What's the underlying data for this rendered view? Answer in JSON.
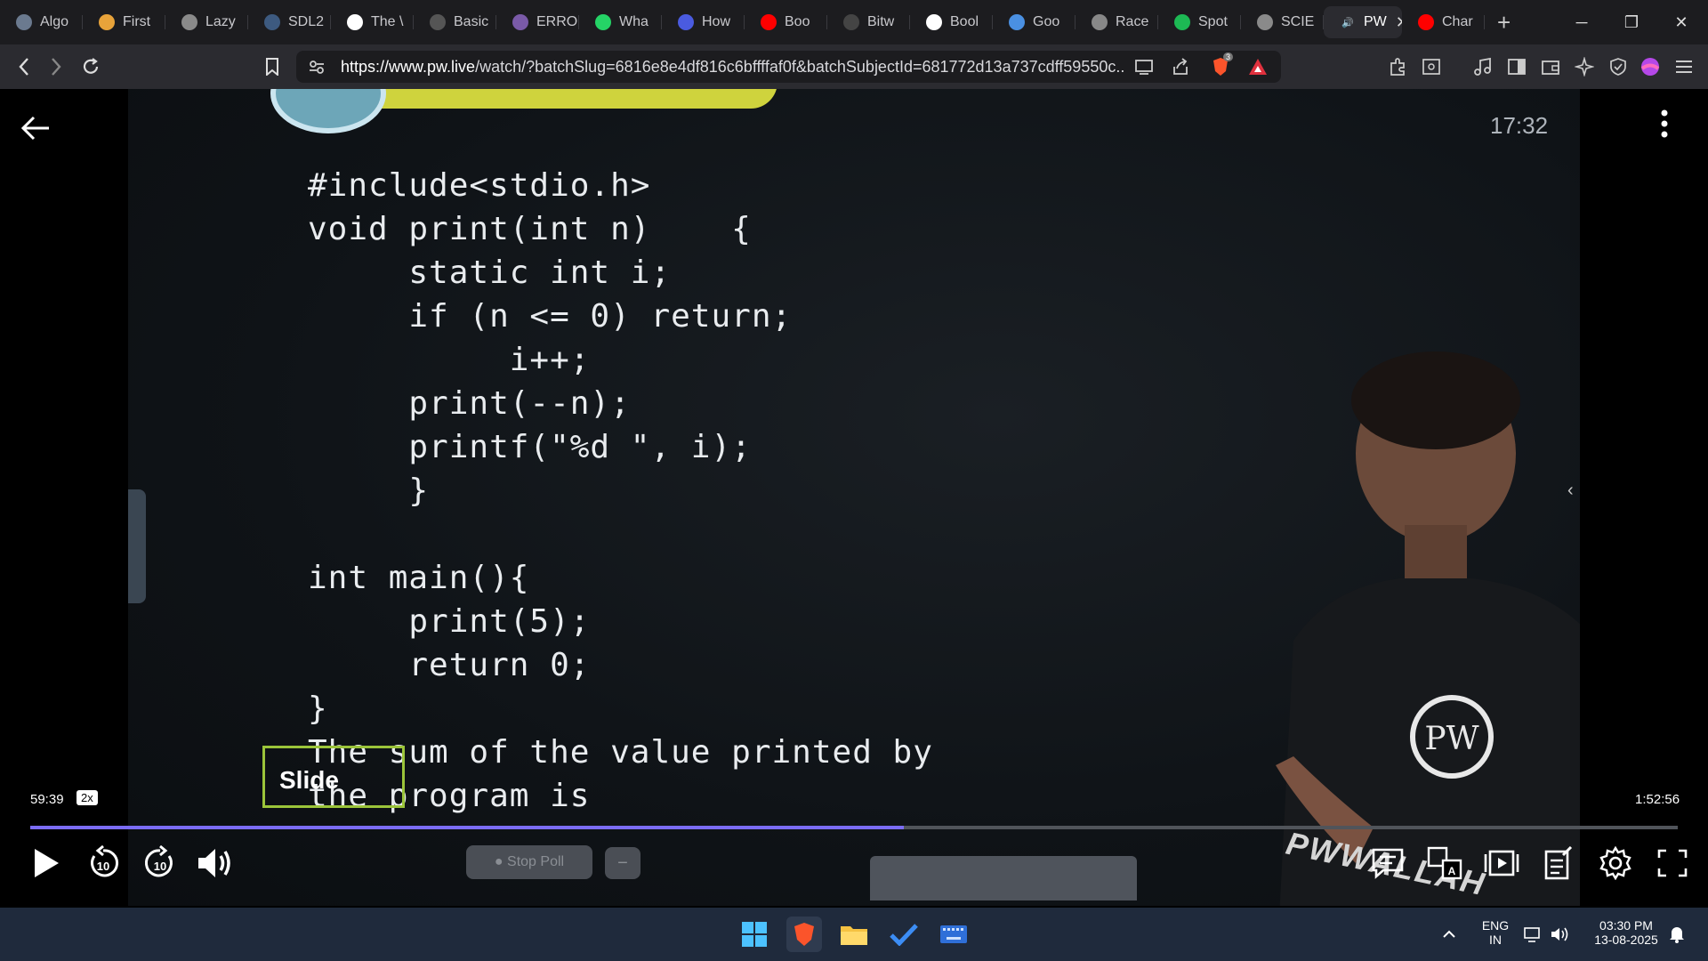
{
  "browser": {
    "tabs": [
      {
        "label": "Algo",
        "icon": "chatgpt-icon",
        "color": "#6b7a8f"
      },
      {
        "label": "First",
        "icon": "stack-icon",
        "color": "#e8a33a"
      },
      {
        "label": "Lazy",
        "icon": "globe-icon",
        "color": "#8a8a8a"
      },
      {
        "label": "SDL2",
        "icon": "sdl-icon",
        "color": "#3d5a80"
      },
      {
        "label": "The \\",
        "icon": "w3schools-icon",
        "color": "#ffffff"
      },
      {
        "label": "Basic",
        "icon": "code-icon",
        "color": "#555"
      },
      {
        "label": "ERRO",
        "icon": "brain-icon",
        "color": "#7a5aa8"
      },
      {
        "label": "Wha",
        "icon": "whatsapp-icon",
        "color": "#25d366"
      },
      {
        "label": "How",
        "icon": "bookmark-icon",
        "color": "#4a5be0"
      },
      {
        "label": "Boo",
        "icon": "youtube-icon",
        "color": "#ff0000"
      },
      {
        "label": "Bitw",
        "icon": "bitwise-icon",
        "color": "#444"
      },
      {
        "label": "Bool",
        "icon": "google-icon",
        "color": "#ffffff"
      },
      {
        "label": "Goo",
        "icon": "gemini-icon",
        "color": "#4a90e2"
      },
      {
        "label": "Race",
        "icon": "openai-icon",
        "color": "#888"
      },
      {
        "label": "Spot",
        "icon": "spotify-icon",
        "color": "#1db954"
      },
      {
        "label": "SCIE",
        "icon": "globe-icon",
        "color": "#8a8a8a"
      }
    ],
    "active_tab": {
      "label": "PW",
      "icon": "speaker-icon",
      "close": "✕"
    },
    "after_tab": {
      "label": "Char",
      "icon": "youtube-icon",
      "color": "#ff0000"
    },
    "new_tab": "+",
    "window_controls": {
      "minimize": "─",
      "restore": "❐",
      "close": "✕"
    },
    "url_host": "https://www.pw.live",
    "url_path": "/watch/?batchSlug=6816e8e4df816c6bffffaf0f&batchSubjectId=681772d13a737cdff59550c...",
    "brave_badge_count": "3"
  },
  "player": {
    "top_time": "17:32",
    "code_lines": [
      "#include<stdio.h>",
      "void print(int n)    {",
      "     static int i;",
      "     if (n <= 0) return;",
      "          i++;",
      "     print(--n);",
      "     printf(\"%d \", i);",
      "     }",
      "",
      "int main(){",
      "     print(5);",
      "     return 0;",
      "}",
      "The sum of the value printed by",
      "the program is"
    ],
    "slide_label": "Slide",
    "current_time": "59:39",
    "speed": "2x",
    "duration": "1:52:56",
    "progress_fraction": 0.53,
    "stop_poll": "● Stop Poll",
    "poll_minimize": "−",
    "watermark": "PWWALLAH",
    "shirt_logo": "PW",
    "skip_back": "10",
    "skip_forward": "10"
  },
  "taskbar": {
    "lang_top": "ENG",
    "lang_bottom": "IN",
    "time": "03:30 PM",
    "date": "13-08-2025"
  }
}
